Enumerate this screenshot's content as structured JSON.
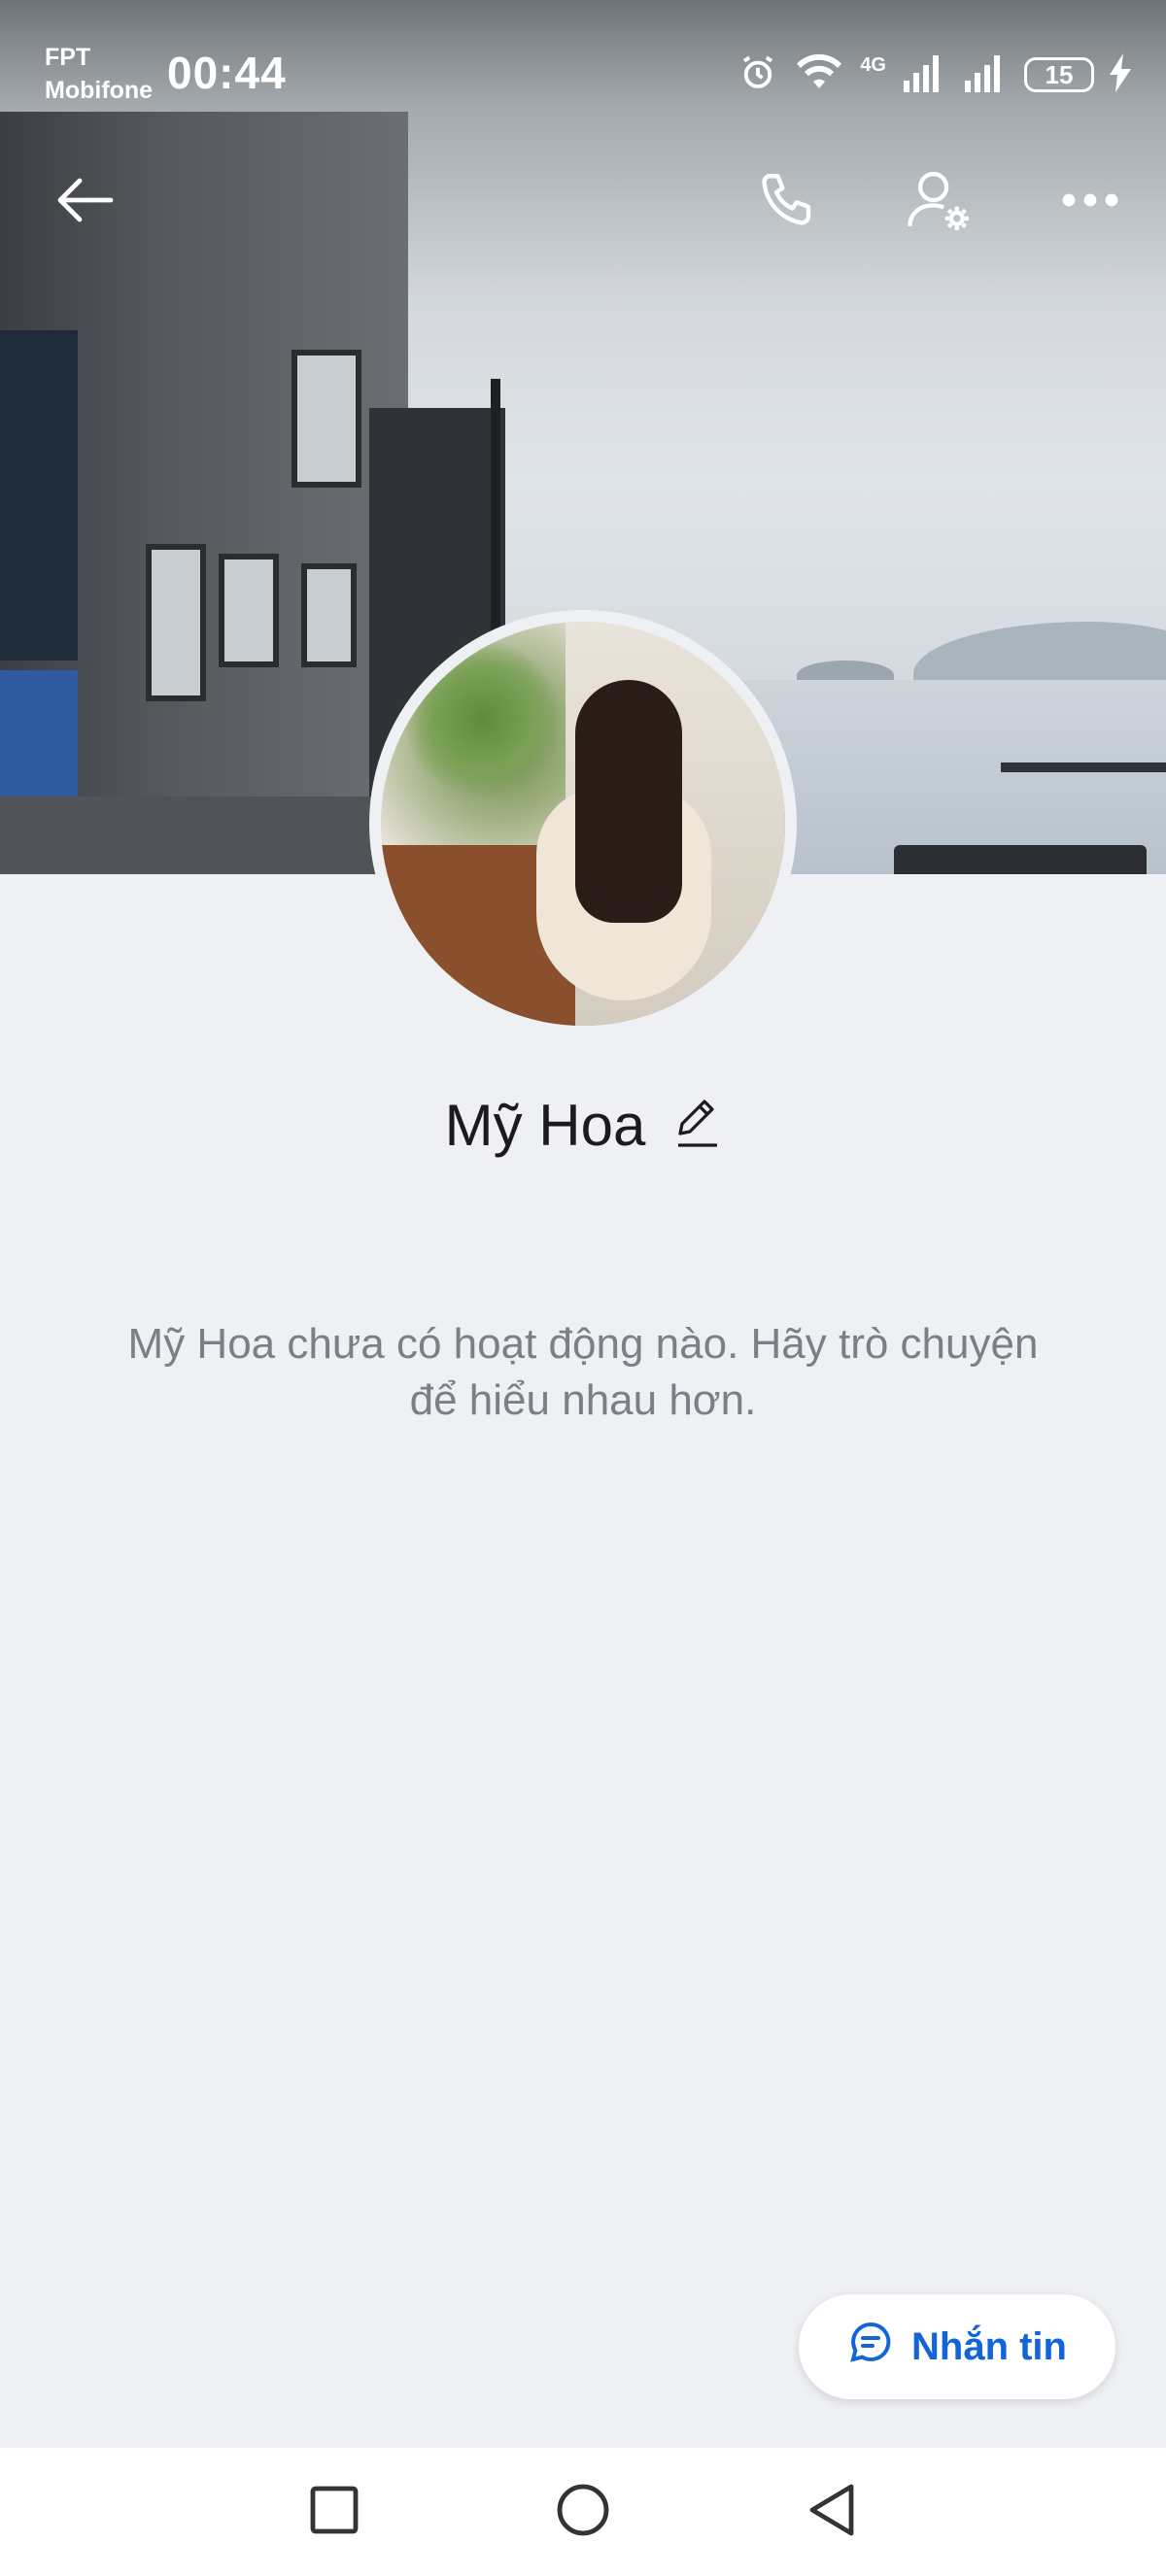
{
  "status_bar": {
    "carrier_line1": "FPT",
    "carrier_line2": "Mobifone",
    "time": "00:44",
    "network": "4G",
    "battery": "15"
  },
  "profile": {
    "name": "Mỹ Hoa",
    "empty_activity": "Mỹ Hoa chưa có hoạt động nào. Hãy trò chuyện để hiểu nhau hơn."
  },
  "actions": {
    "message_label": "Nhắn tin"
  },
  "icons": {
    "back": "arrow-left-icon",
    "call": "phone-icon",
    "profile_settings": "user-settings-icon",
    "more": "more-horizontal-icon",
    "edit": "pencil-icon",
    "chat": "chat-bubble-icon"
  },
  "colors": {
    "accent": "#1265d8",
    "background": "#eef0f4"
  }
}
